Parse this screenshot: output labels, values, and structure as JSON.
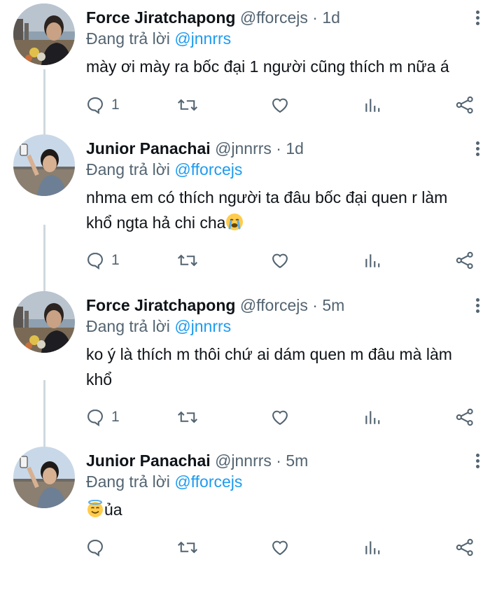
{
  "reply_prefix": "Đang trả lời",
  "tweets": [
    {
      "name": "Force Jiratchapong",
      "meta": "@fforcejs · 1d",
      "reply_to": "@jnnrrs",
      "text": "mày ơi mày ra bốc đại 1 người cũng thích m nữa á",
      "text_line2": "",
      "reply_count": "1",
      "avatar": "sunset-avatar-icon"
    },
    {
      "name": "Junior Panachai",
      "meta": "@jnnrrs · 1d",
      "reply_to": "@fforcejs",
      "text": "nhma em có thích người ta đâu bốc đại quen r làm",
      "text_line2": "khổ ngta hả chi cha",
      "reply_count": "1",
      "emoji": "crying-face-icon",
      "avatar": "selfie-avatar-icon"
    },
    {
      "name": "Force Jiratchapong",
      "meta": "@fforcejs · 5m",
      "reply_to": "@jnnrrs",
      "text": "ko ý là thích m thôi chứ ai dám quen m đâu mà làm",
      "text_line2": "khổ",
      "reply_count": "1",
      "avatar": "sunset-avatar-icon"
    },
    {
      "name": "Junior Panachai",
      "meta": "@jnnrrs · 5m",
      "reply_to": "@fforcejs",
      "text": "ủa",
      "text_line2": "",
      "reply_count": "",
      "emoji": "halo-face-icon",
      "avatar": "selfie-avatar-icon"
    }
  ],
  "colors": {
    "link": "#1d9bf0",
    "muted": "#536471",
    "line": "#cfd9de"
  }
}
